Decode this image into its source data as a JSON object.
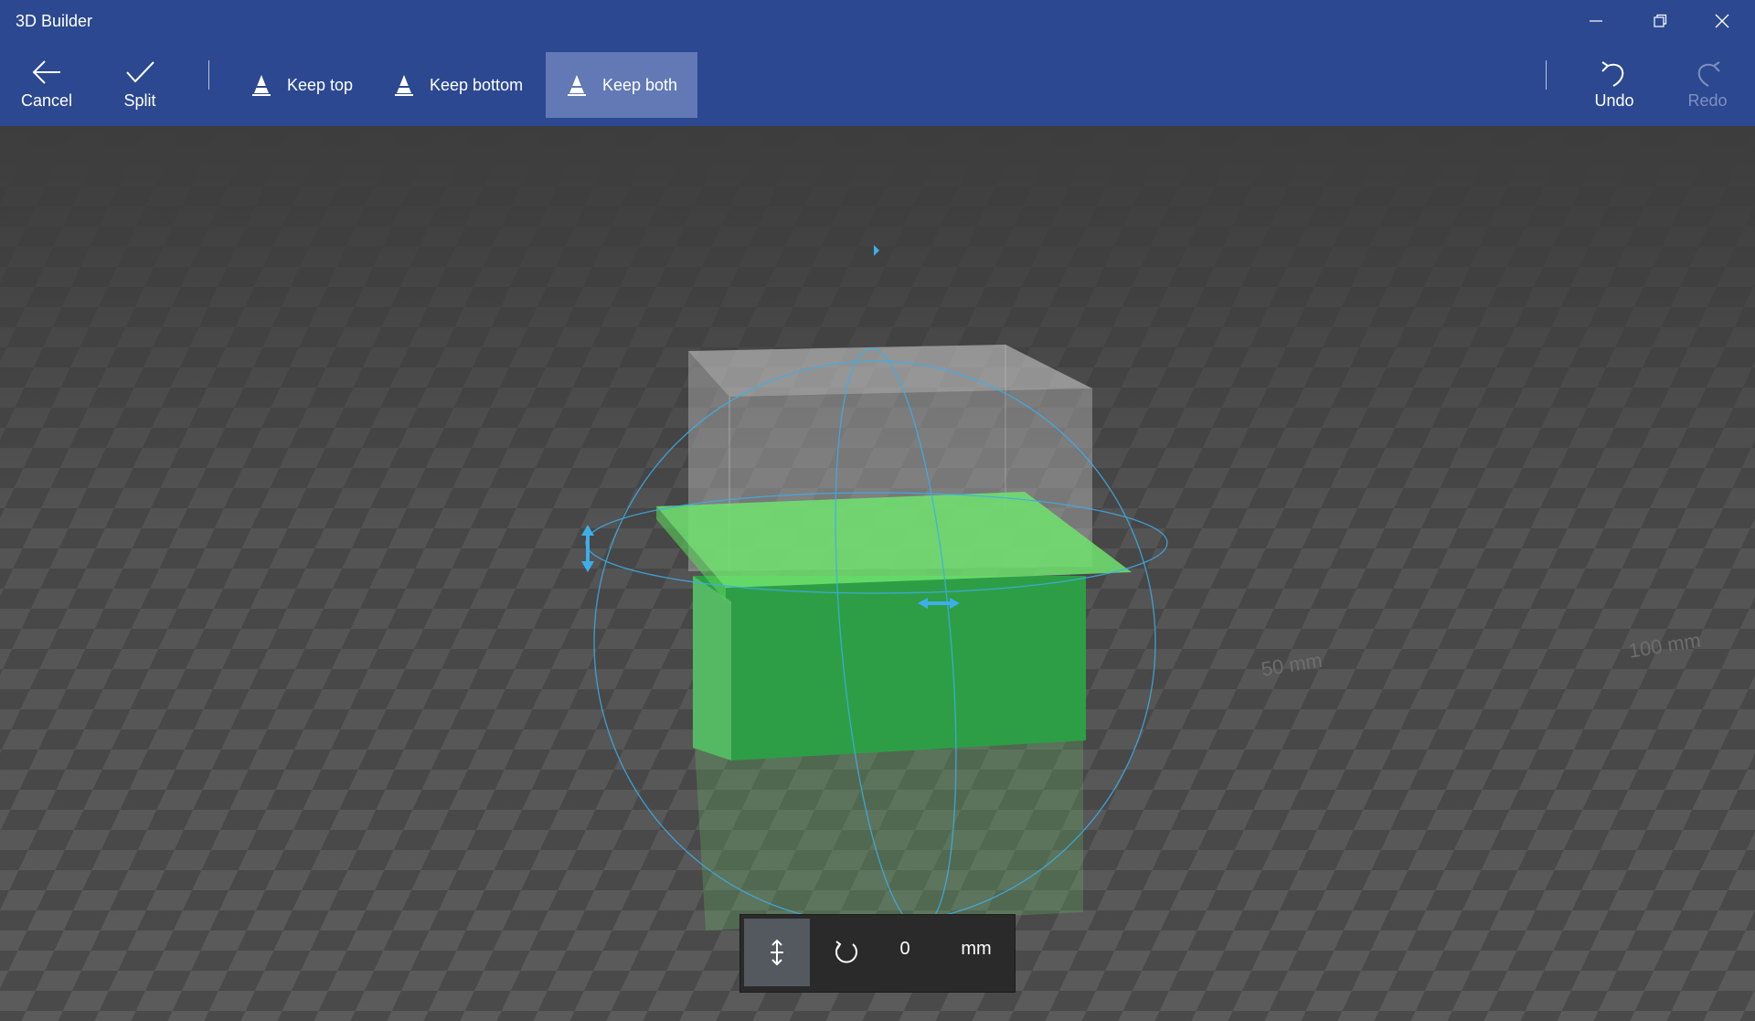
{
  "window": {
    "title": "3D Builder",
    "controls": [
      "minimize-icon",
      "restore-icon",
      "close-icon"
    ]
  },
  "toolbar": {
    "cancel_label": "Cancel",
    "split_label": "Split",
    "keep_options": [
      {
        "label": "Keep top",
        "active": false
      },
      {
        "label": "Keep bottom",
        "active": false
      },
      {
        "label": "Keep both",
        "active": true
      }
    ],
    "undo_label": "Undo",
    "redo_label": "Redo",
    "redo_enabled": false
  },
  "viewport": {
    "floor_labels": [
      "50 mm",
      "100 mm"
    ],
    "colors": {
      "bottom_part": "#2e9e46",
      "cut_plane": "#6fe36f",
      "gizmo": "#3daee9",
      "title_bar": "#2b4891",
      "active_option": "#6279b6"
    }
  },
  "transform_panel": {
    "offset_value": "0",
    "unit": "mm",
    "active_mode": "move"
  }
}
